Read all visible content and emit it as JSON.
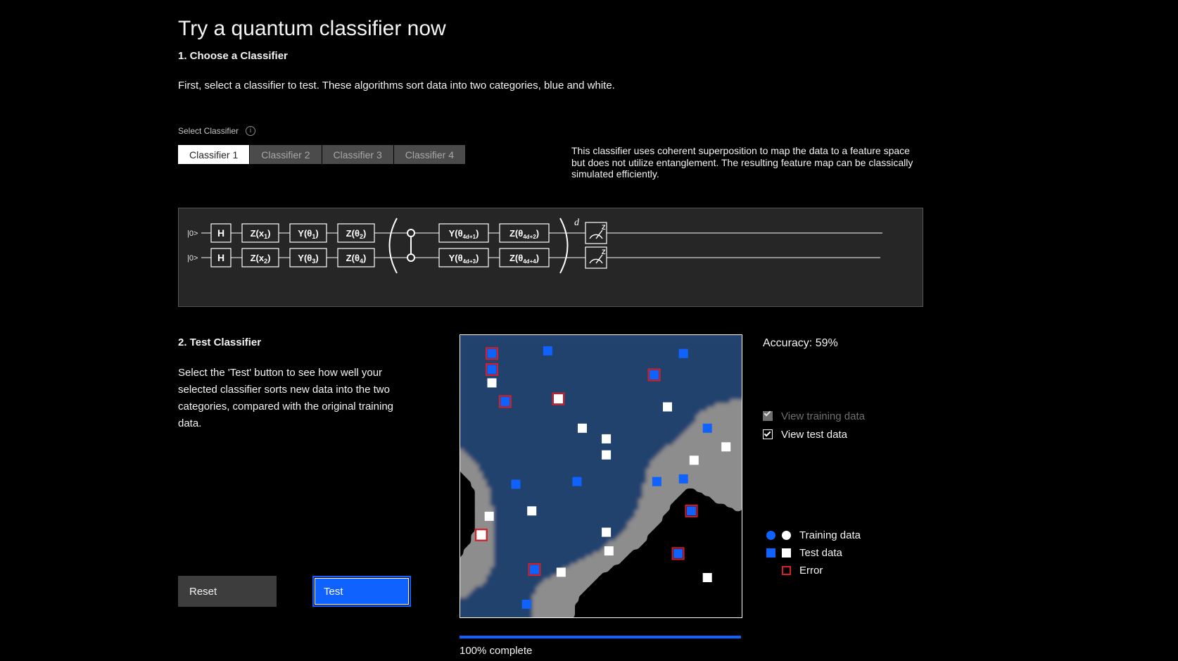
{
  "page": {
    "title": "Try a quantum classifier now"
  },
  "step1": {
    "heading": "1. Choose a Classifier",
    "description": "First, select a classifier to test. These algorithms sort data into two categories, blue and white.",
    "select_label": "Select Classifier",
    "info_icon": "info-icon",
    "tabs": [
      {
        "label": "Classifier 1",
        "active": true
      },
      {
        "label": "Classifier 2",
        "active": false
      },
      {
        "label": "Classifier 3",
        "active": false
      },
      {
        "label": "Classifier 4",
        "active": false
      }
    ],
    "classifier_description": "This classifier uses coherent superposition to map the data to a feature space but does not utilize entanglement. The resulting feature map can be classically simulated efficiently."
  },
  "circuit": {
    "qubit_labels": [
      "|0>",
      "|0>"
    ],
    "row1_gates": [
      "H",
      "Z(x₁)",
      "Y(θ₁)",
      "Z(θ₂)",
      "Y(θ₄d₊₁)",
      "Z(θ₄d₊₂)"
    ],
    "row2_gates": [
      "H",
      "Z(x₂)",
      "Y(θ₃)",
      "Z(θ₄)",
      "Y(θ₄d₊₃)",
      "Z(θ₄d₊₄)"
    ],
    "repeat_label": "d",
    "measure_basis": "Z"
  },
  "step2": {
    "heading": "2. Test Classifier",
    "description": "Select the 'Test' button to see how well your selected classifier sorts new data into the two categories, compared with the original training data.",
    "reset_button": "Reset",
    "test_button": "Test"
  },
  "results": {
    "accuracy_label": "Accuracy: 59%",
    "accuracy_value": 59,
    "progress_label": "100% complete",
    "progress_value": 100,
    "checkboxes": [
      {
        "label": "View training data",
        "checked": true,
        "disabled": true
      },
      {
        "label": "View test data",
        "checked": true,
        "disabled": false
      }
    ],
    "legend": [
      {
        "label": "Training data",
        "shape": "circle",
        "colors": [
          "#0f62fe",
          "#ffffff"
        ]
      },
      {
        "label": "Test data",
        "shape": "square",
        "colors": [
          "#0f62fe",
          "#ffffff"
        ]
      },
      {
        "label": "Error",
        "shape": "square-outline",
        "colors": [
          "#da1e28"
        ]
      }
    ]
  },
  "colors": {
    "accent_blue": "#0f62fe",
    "region_blue": "#23426e",
    "region_gray": "#8d8d8d",
    "region_black": "#000000",
    "error_red": "#da1e28",
    "panel_bg": "#262626"
  },
  "chart_data": {
    "type": "scatter",
    "title": "Classifier decision boundary with test points",
    "xlabel": "",
    "ylabel": "",
    "xlim": [
      0,
      1
    ],
    "ylim": [
      0,
      1
    ],
    "grid": false,
    "legend_position": "right",
    "region_classes": [
      "blue",
      "gray",
      "black"
    ],
    "points": [
      {
        "x": 0.09,
        "y": 0.96,
        "class": "blue",
        "error": true
      },
      {
        "x": 0.3,
        "y": 0.97,
        "class": "blue",
        "error": false
      },
      {
        "x": 0.81,
        "y": 0.96,
        "class": "blue",
        "error": false
      },
      {
        "x": 0.09,
        "y": 0.9,
        "class": "blue",
        "error": true
      },
      {
        "x": 0.7,
        "y": 0.88,
        "class": "blue",
        "error": true
      },
      {
        "x": 0.09,
        "y": 0.85,
        "class": "white",
        "error": false
      },
      {
        "x": 0.34,
        "y": 0.79,
        "class": "white",
        "error": true
      },
      {
        "x": 0.14,
        "y": 0.78,
        "class": "blue",
        "error": true
      },
      {
        "x": 0.75,
        "y": 0.76,
        "class": "white",
        "error": false
      },
      {
        "x": 0.43,
        "y": 0.68,
        "class": "white",
        "error": false
      },
      {
        "x": 0.9,
        "y": 0.68,
        "class": "blue",
        "error": false
      },
      {
        "x": 0.52,
        "y": 0.64,
        "class": "white",
        "error": false
      },
      {
        "x": 0.97,
        "y": 0.61,
        "class": "white",
        "error": false
      },
      {
        "x": 0.52,
        "y": 0.58,
        "class": "white",
        "error": false
      },
      {
        "x": 0.85,
        "y": 0.56,
        "class": "white",
        "error": false
      },
      {
        "x": 0.18,
        "y": 0.47,
        "class": "blue",
        "error": false
      },
      {
        "x": 0.41,
        "y": 0.48,
        "class": "blue",
        "error": false
      },
      {
        "x": 0.71,
        "y": 0.48,
        "class": "blue",
        "error": false
      },
      {
        "x": 0.81,
        "y": 0.49,
        "class": "blue",
        "error": false
      },
      {
        "x": 0.08,
        "y": 0.35,
        "class": "white",
        "error": false
      },
      {
        "x": 0.24,
        "y": 0.37,
        "class": "white",
        "error": false
      },
      {
        "x": 0.84,
        "y": 0.37,
        "class": "blue",
        "error": true
      },
      {
        "x": 0.05,
        "y": 0.28,
        "class": "white",
        "error": true
      },
      {
        "x": 0.52,
        "y": 0.29,
        "class": "white",
        "error": false
      },
      {
        "x": 0.53,
        "y": 0.22,
        "class": "white",
        "error": false
      },
      {
        "x": 0.79,
        "y": 0.21,
        "class": "blue",
        "error": true
      },
      {
        "x": 0.25,
        "y": 0.15,
        "class": "blue",
        "error": true
      },
      {
        "x": 0.35,
        "y": 0.14,
        "class": "white",
        "error": false
      },
      {
        "x": 0.9,
        "y": 0.12,
        "class": "white",
        "error": false
      },
      {
        "x": 0.22,
        "y": 0.02,
        "class": "blue",
        "error": false
      }
    ]
  }
}
